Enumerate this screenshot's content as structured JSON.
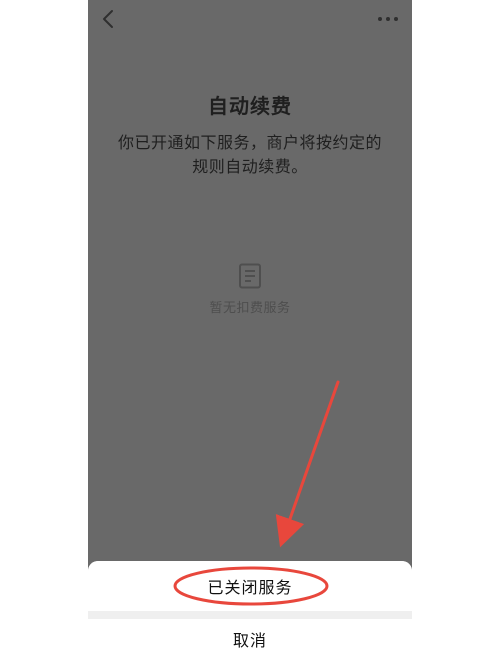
{
  "header": {
    "back_icon": "chevron-left-icon",
    "more_icon": "more-dots-icon"
  },
  "main": {
    "title": "自动续费",
    "description": "你已开通如下服务，商户将按约定的规则自动续费。",
    "empty_state": {
      "icon": "document-icon",
      "text": "暂无扣费服务"
    }
  },
  "action_sheet": {
    "status_text": "已关闭服务",
    "cancel_label": "取消"
  },
  "annotation": {
    "color": "#e8473c",
    "type": "arrow-and-ellipse"
  },
  "colors": {
    "overlay_gray": "#696969",
    "sheet_bg": "#ffffff",
    "separator": "#efefef"
  }
}
